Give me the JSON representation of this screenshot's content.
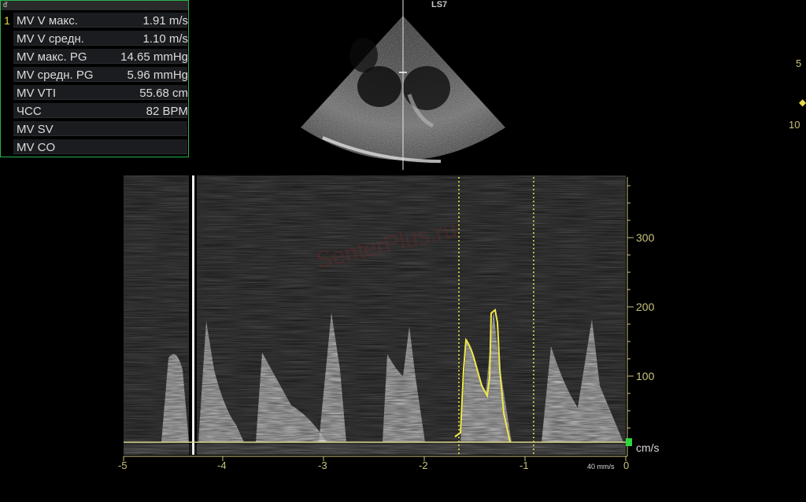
{
  "measurements": {
    "header_glyph": "ᵭ",
    "active_index": "1",
    "rows": [
      {
        "label": "MV V макс.",
        "value": "1.91 m/s"
      },
      {
        "label": "MV V средн.",
        "value": "1.10 m/s"
      },
      {
        "label": "MV макс. PG",
        "value": "14.65 mmHg"
      },
      {
        "label": "MV средн. PG",
        "value": "5.96 mmHg"
      },
      {
        "label": "MV VTI",
        "value": "55.68 cm"
      },
      {
        "label": "ЧСС",
        "value": "82 BPM"
      },
      {
        "label": "MV SV",
        "value": ""
      },
      {
        "label": "MV CO",
        "value": ""
      }
    ]
  },
  "image": {
    "probe_label": "LS7",
    "depth_marks": [
      "5",
      "10"
    ],
    "watermark": "SenterPlus.ru"
  },
  "doppler": {
    "velocity_ticks": [
      "300",
      "200",
      "100"
    ],
    "time_ticks": [
      "-5",
      "-4",
      "-3",
      "-2",
      "-1",
      "0"
    ],
    "unit": "cm/s",
    "sweep_speed": "40 mm/s",
    "colors": {
      "scale": "#c7c27e",
      "trace": "#f0e84a",
      "panel_border": "#27b34a",
      "baseline_marker": "#2dd83a"
    }
  }
}
